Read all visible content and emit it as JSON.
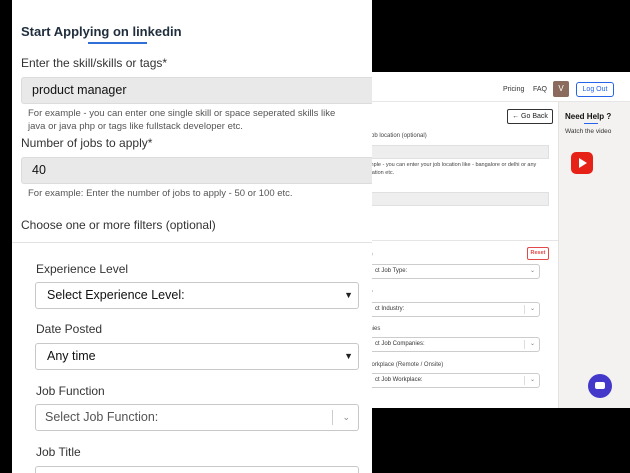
{
  "back_window": {
    "nav": {
      "pricing": "Pricing",
      "faq": "FAQ",
      "avatar_initial": "V",
      "logout": "Log Out"
    },
    "go_back": "← Go Back",
    "help": {
      "title": "Need Help ?",
      "watch": "Watch the video"
    },
    "location_label": "r job location (optional)",
    "location_hint_line1": "ample - you can enter your job location like - bangalore or delhi or any",
    "location_hint_line2": "ocation etc.",
    "filters": {
      "reset": "Reset",
      "job_type_label": "pe",
      "job_type_value": "ct Job Type:",
      "industry_label": "try",
      "industry_value": "ct Industry:",
      "companies_label": "anies",
      "companies_value": "ct Job Companies:",
      "workplace_label": "Workplace (Remote / Onsite)",
      "workplace_value": "ct Job Workplace:"
    }
  },
  "front_window": {
    "heading": "Start Applying on linkedin",
    "skills": {
      "label": "Enter the skill/skills or tags*",
      "value": "product manager",
      "hint_line1": "For example - you can enter one single skill or space seperated skills like",
      "hint_line2": "java or java php or tags like fullstack developer etc."
    },
    "jobs_count": {
      "label": "Number of jobs to apply*",
      "value": "40",
      "hint": "For example: Enter the number of jobs to apply - 50 or 100 etc."
    },
    "filters_heading": "Choose one or more filters (optional)",
    "experience": {
      "label": "Experience Level",
      "value": "Select Experience Level:"
    },
    "date_posted": {
      "label": "Date Posted",
      "value": "Any time"
    },
    "job_function": {
      "label": "Job Function",
      "value": "Select Job Function:"
    },
    "job_title": {
      "label": "Job Title"
    }
  }
}
